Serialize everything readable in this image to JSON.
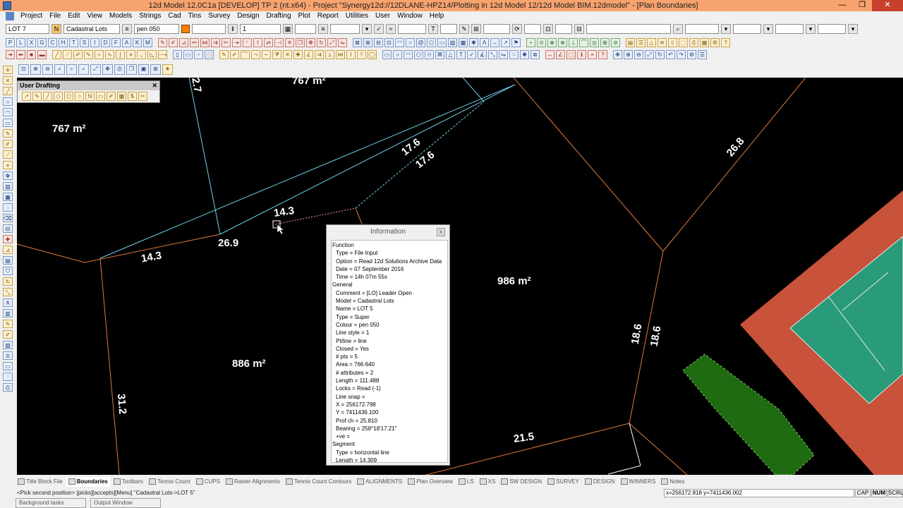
{
  "window": {
    "title": "12d Model  12.0C1a [DEVELOP] TP 2 (nt.x64) - Project \"Synergy12d://12DLANE-HPZ14/Plotting in 12d Model 12/12d Model BIM.12dmodel\" - [Plan Boundaries]",
    "minimize": "—",
    "maximize": "❐",
    "close": "✕"
  },
  "menu": [
    "Project",
    "File",
    "Edit",
    "View",
    "Models",
    "Strings",
    "Cad",
    "Tins",
    "Survey",
    "Design",
    "Drafting",
    "Plot",
    "Report",
    "Utilities",
    "User",
    "Window",
    "Help"
  ],
  "propbar": {
    "name": "LOT 7",
    "name_btn": "N",
    "model": "Cadastral Lots",
    "colour": "pen 050",
    "weight": "1",
    "text_btn": "T"
  },
  "toolbar_row1": [
    "P",
    "L",
    "X",
    "G",
    "C",
    "H",
    "T",
    "S",
    "I",
    "D",
    "F",
    "A",
    "K",
    "M"
  ],
  "user_drafting": {
    "title": "User Drafting",
    "close": "✕"
  },
  "canvas": {
    "labels": {
      "area_top": "767 m²",
      "area_left": "767 m²",
      "area_mid": "986 m²",
      "area_lower": "886 m²",
      "d_27": "2.7",
      "d_176a": "17.6",
      "d_176b": "17.6",
      "d_268": "26.8",
      "d_143a": "14.3",
      "d_269": "26.9",
      "d_143b": "14.3",
      "d_186a": "18.6",
      "d_186b": "18.6",
      "d_312": "31.2",
      "d_215": "21.5"
    }
  },
  "info": {
    "title": "Information",
    "close": "x",
    "lines": [
      {
        "text": "Function",
        "indent": false
      },
      {
        "text": "Type = File Input",
        "indent": true
      },
      {
        "text": "Option = Read 12d Solutions Archive Data",
        "indent": true
      },
      {
        "text": "Date = 07 September 2016",
        "indent": true
      },
      {
        "text": "Time = 14h 07m 55s",
        "indent": true
      },
      {
        "text": "General",
        "indent": false
      },
      {
        "text": "Comment = [LO]  Leader Open",
        "indent": true
      },
      {
        "text": "Model = Cadastral Lots",
        "indent": true
      },
      {
        "text": "Name = LOT 5",
        "indent": true
      },
      {
        "text": "Type = Super",
        "indent": true
      },
      {
        "text": "Colour = pen 050",
        "indent": true
      },
      {
        "text": "Line style = 1",
        "indent": true
      },
      {
        "text": "Pt/line = line",
        "indent": true
      },
      {
        "text": "Closed = Yes",
        "indent": true
      },
      {
        "text": "# pts = 5",
        "indent": true
      },
      {
        "text": "Area = 766.640",
        "indent": true
      },
      {
        "text": "# attributes = 2",
        "indent": true
      },
      {
        "text": "Length = 111.488",
        "indent": true
      },
      {
        "text": "Locks = Read (-1)",
        "indent": true
      },
      {
        "text": "Line snap =",
        "indent": true
      },
      {
        "text": "X = 256172.798",
        "indent": true
      },
      {
        "text": "Y = 7411436.100",
        "indent": true
      },
      {
        "text": "Prof ch = 25.810",
        "indent": true
      },
      {
        "text": "Bearing = 258°18'17.21\"",
        "indent": true
      },
      {
        "text": "+ve =",
        "indent": true
      },
      {
        "text": "Segment",
        "indent": false
      },
      {
        "text": "Type = horizontal line",
        "indent": true
      },
      {
        "text": "Length = 14.309",
        "indent": true
      }
    ]
  },
  "tabs": [
    {
      "label": "Title Block File",
      "active": false
    },
    {
      "label": "Boundaries",
      "active": true
    },
    {
      "label": "Toolbars",
      "active": false
    },
    {
      "label": "Tennis Count",
      "active": false
    },
    {
      "label": "CUPS",
      "active": false
    },
    {
      "label": "Raster Alignments",
      "active": false
    },
    {
      "label": "Tennis Count Contours",
      "active": false
    },
    {
      "label": "ALIGNMENTS",
      "active": false
    },
    {
      "label": "Plan Overview",
      "active": false
    },
    {
      "label": "LS",
      "active": false
    },
    {
      "label": "XS",
      "active": false
    },
    {
      "label": "SW DESIGN",
      "active": false
    },
    {
      "label": "SURVEY",
      "active": false
    },
    {
      "label": "DESIGN",
      "active": false
    },
    {
      "label": "WINNERS",
      "active": false
    },
    {
      "label": "Notes",
      "active": false
    }
  ],
  "status": {
    "message": "<Pick second position> [picks][accepts][Menu] \"Cadastral Lots->LOT 5\"",
    "coords": "x=256172.818 y=7411436.002",
    "keys": [
      "CAP",
      "NUM",
      "SCRL"
    ]
  },
  "panes": [
    "Background tasks",
    "Output Window"
  ],
  "colors": {
    "lot_line": "#e07a3a",
    "easement_line": "#6fd0e8",
    "court_surround": "#c8523a",
    "court_green": "#2a9b7a",
    "vegetation": "#1f6b12"
  }
}
